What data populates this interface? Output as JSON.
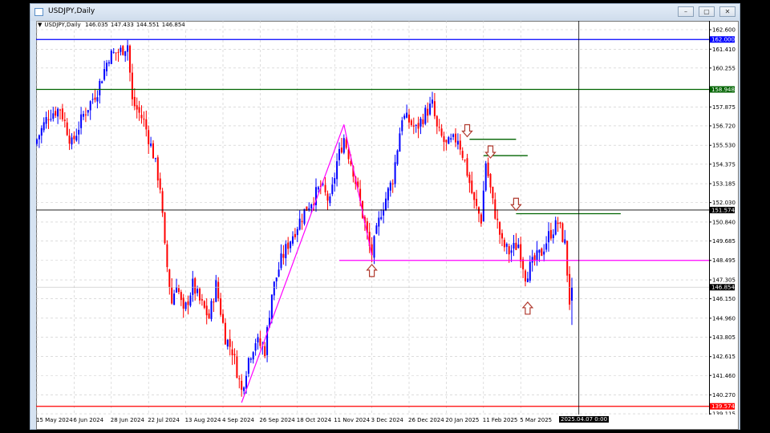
{
  "window": {
    "title": "USDJPY,Daily",
    "buttons": [
      "minimize",
      "restore",
      "close"
    ]
  },
  "info_bar": {
    "symbol": "USDJPY,Daily",
    "open": "146.035",
    "high": "147.433",
    "low": "144.551",
    "close": "146.854"
  },
  "crosshair_label": "2025.04.07 0:00",
  "colors": {
    "bull": "#0000ff",
    "bear": "#ff0000",
    "grid": "#c8c8c8"
  },
  "chart_data": {
    "type": "candlestick",
    "title": "USDJPY,Daily",
    "ylim": [
      139.115,
      162.6
    ],
    "y_ticks": [
      "162.600",
      "161.410",
      "160.255",
      "157.875",
      "156.720",
      "155.530",
      "154.375",
      "153.185",
      "152.030",
      "150.840",
      "149.685",
      "148.495",
      "147.305",
      "146.150",
      "144.960",
      "143.805",
      "142.615",
      "141.460",
      "140.270",
      "139.115"
    ],
    "x_ticks": [
      {
        "bar": 0,
        "label": "15 May 2024"
      },
      {
        "bar": 16,
        "label": "6 Jun 2024"
      },
      {
        "bar": 32,
        "label": "28 Jun 2024"
      },
      {
        "bar": 48,
        "label": "22 Jul 2024"
      },
      {
        "bar": 64,
        "label": "13 Aug 2024"
      },
      {
        "bar": 80,
        "label": "4 Sep 2024"
      },
      {
        "bar": 96,
        "label": "26 Sep 2024"
      },
      {
        "bar": 112,
        "label": "18 Oct 2024"
      },
      {
        "bar": 128,
        "label": "11 Nov 2024"
      },
      {
        "bar": 144,
        "label": "3 Dec 2024"
      },
      {
        "bar": 160,
        "label": "26 Dec 2024"
      },
      {
        "bar": 176,
        "label": "20 Jan 2025"
      },
      {
        "bar": 192,
        "label": "11 Feb 2025"
      },
      {
        "bar": 208,
        "label": "5 Mar 2025"
      }
    ],
    "close_anchors": [
      [
        0,
        155.9
      ],
      [
        5,
        157.4
      ],
      [
        10,
        157.8
      ],
      [
        15,
        155.6
      ],
      [
        20,
        157.4
      ],
      [
        26,
        158.9
      ],
      [
        31,
        161.0
      ],
      [
        36,
        161.3
      ],
      [
        39,
        161.7
      ],
      [
        41,
        158.2
      ],
      [
        46,
        157.0
      ],
      [
        50,
        155.0
      ],
      [
        53,
        153.0
      ],
      [
        55,
        149.2
      ],
      [
        58,
        145.9
      ],
      [
        60,
        147.2
      ],
      [
        63,
        145.2
      ],
      [
        67,
        147.0
      ],
      [
        70,
        146.0
      ],
      [
        74,
        145.0
      ],
      [
        77,
        147.0
      ],
      [
        81,
        143.8
      ],
      [
        84,
        143.0
      ],
      [
        88,
        140.5
      ],
      [
        91,
        142.5
      ],
      [
        94,
        143.6
      ],
      [
        98,
        143.0
      ],
      [
        101,
        146.5
      ],
      [
        105,
        148.5
      ],
      [
        108,
        149.5
      ],
      [
        115,
        151.5
      ],
      [
        122,
        153.0
      ],
      [
        126,
        152.0
      ],
      [
        129,
        154.5
      ],
      [
        132,
        156.0
      ],
      [
        136,
        154.0
      ],
      [
        139,
        152.0
      ],
      [
        143,
        149.3
      ],
      [
        144,
        148.9
      ],
      [
        148,
        151.5
      ],
      [
        153,
        153.5
      ],
      [
        157,
        157.3
      ],
      [
        160,
        157.0
      ],
      [
        163,
        156.5
      ],
      [
        167,
        157.5
      ],
      [
        170,
        158.0
      ],
      [
        172,
        156.5
      ],
      [
        176,
        155.5
      ],
      [
        181,
        156.0
      ],
      [
        184,
        154.5
      ],
      [
        188,
        152.0
      ],
      [
        191,
        151.0
      ],
      [
        193,
        154.5
      ],
      [
        196,
        152.0
      ],
      [
        200,
        149.5
      ],
      [
        203,
        149.0
      ],
      [
        207,
        149.5
      ],
      [
        210,
        147.6
      ],
      [
        214,
        148.5
      ],
      [
        217,
        149.0
      ],
      [
        220,
        150.0
      ],
      [
        224,
        150.8
      ],
      [
        227,
        149.5
      ],
      [
        229,
        146.0
      ],
      [
        230,
        146.854
      ]
    ],
    "last_bar": {
      "open": 146.035,
      "high": 147.433,
      "low": 144.551,
      "close": 146.854
    },
    "levels": [
      {
        "name": "resistance-162",
        "price": 162.0,
        "label": "162.000",
        "color": "#0000ff"
      },
      {
        "name": "resistance-158",
        "price": 158.948,
        "label": "158.948",
        "color": "#006400"
      },
      {
        "name": "crosshair-price",
        "price": 151.574,
        "label": "151.574",
        "color": "#000000"
      },
      {
        "name": "support-139",
        "price": 139.574,
        "label": "139.574",
        "color": "#ff0000"
      }
    ],
    "current_price_label": "146.854",
    "neckline": {
      "price": 148.495,
      "from_bar": 130,
      "color": "#ff00ff"
    },
    "short_levels": [
      {
        "price": 155.9,
        "from_bar": 186,
        "to_bar": 206
      },
      {
        "price": 154.9,
        "from_bar": 192,
        "to_bar": 211
      },
      {
        "price": 151.35,
        "from_bar": 206,
        "to_bar": 251
      }
    ],
    "trendlines": [
      {
        "from": [
          88,
          139.8
        ],
        "to": [
          132,
          156.8
        ]
      },
      {
        "from": [
          132,
          156.8
        ],
        "to": [
          144,
          148.8
        ]
      }
    ],
    "arrows": [
      {
        "dir": "down",
        "bar": 185,
        "price": 156.4
      },
      {
        "dir": "down",
        "bar": 195,
        "price": 155.1
      },
      {
        "dir": "down",
        "bar": 206,
        "price": 151.9
      },
      {
        "dir": "up",
        "bar": 144,
        "price": 147.9
      },
      {
        "dir": "up",
        "bar": 211,
        "price": 145.6
      }
    ],
    "crosshair_bar": 233
  }
}
